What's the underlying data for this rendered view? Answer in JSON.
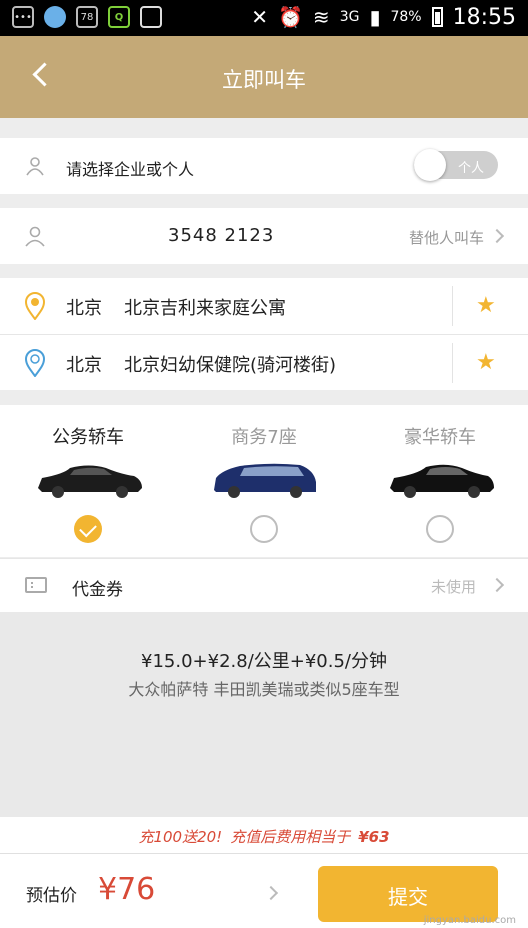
{
  "status_bar": {
    "notif_badge": "78",
    "network": "3G",
    "battery": "78%",
    "time": "18:55"
  },
  "header": {
    "title": "立即叫车"
  },
  "account": {
    "label": "请选择企业或个人",
    "toggle_label": "个人"
  },
  "contact": {
    "phone": "3548   2123",
    "other_label": "替他人叫车"
  },
  "route": {
    "start": {
      "city": "北京",
      "place": "北京吉利来家庭公寓"
    },
    "end": {
      "city": "北京",
      "place": "北京妇幼保健院(骑河楼街)"
    }
  },
  "car_types": [
    {
      "label": "公务轿车",
      "selected": true
    },
    {
      "label": "商务7座",
      "selected": false
    },
    {
      "label": "豪华轿车",
      "selected": false
    }
  ],
  "coupon": {
    "label": "代金券",
    "status": "未使用"
  },
  "pricing": {
    "rule": "¥15.0+¥2.8/公里+¥0.5/分钟",
    "models": "大众帕萨特 丰田凯美瑞或类似5座车型"
  },
  "promo": {
    "offer": "充100送20!",
    "text": "充值后费用相当于",
    "amount": "¥63"
  },
  "bottom": {
    "estimate_label": "预估价",
    "estimate_value": "¥76",
    "submit_label": "提交"
  },
  "watermark": "jingyan.baidu.com",
  "colors": {
    "header": "#c4a977",
    "accent": "#f2b531",
    "price": "#d84a37"
  }
}
